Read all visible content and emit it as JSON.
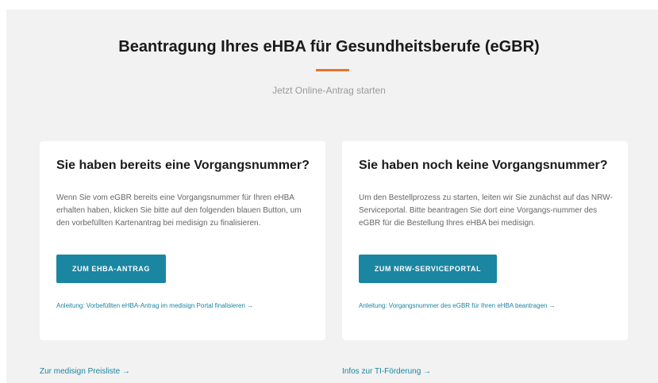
{
  "header": {
    "title": "Beantragung Ihres eHBA für Gesundheitsberufe (eGBR)",
    "subtitle": "Jetzt Online-Antrag starten"
  },
  "cards": [
    {
      "heading": "Sie haben bereits eine Vorgangsnummer?",
      "text": "Wenn Sie vom eGBR bereits eine Vorgangsnummer für Ihren eHBA erhalten haben, klicken Sie bitte auf den folgenden blauen Button, um den vorbefüllten Kartenantrag bei medisign zu finalisieren.",
      "button_label": "ZUM EHBA-ANTRAG",
      "guide_link": "Anleitung: Vorbefüllten eHBA-Antrag im medisign Portal finalisieren →"
    },
    {
      "heading": "Sie haben noch keine Vorgangsnummer?",
      "text": "Um den Bestellprozess zu starten, leiten wir Sie zunächst auf das NRW-Serviceportal. Bitte beantragen Sie dort eine Vorgangs-nummer des eGBR für die Bestellung Ihres eHBA bei medisign.",
      "button_label": "ZUM NRW-SERVICEPORTAL",
      "guide_link": "Anleitung: Vorgangsnummer des eGBR für Ihren eHBA beantragen →"
    }
  ],
  "footer": {
    "price_list_link": "Zur medisign Preisliste →",
    "funding_link": "Infos zur TI-Förderung →"
  },
  "colors": {
    "accent": "#e8732a",
    "button": "#1b86a1",
    "link": "#1b86a1",
    "background": "#f2f2f2"
  }
}
